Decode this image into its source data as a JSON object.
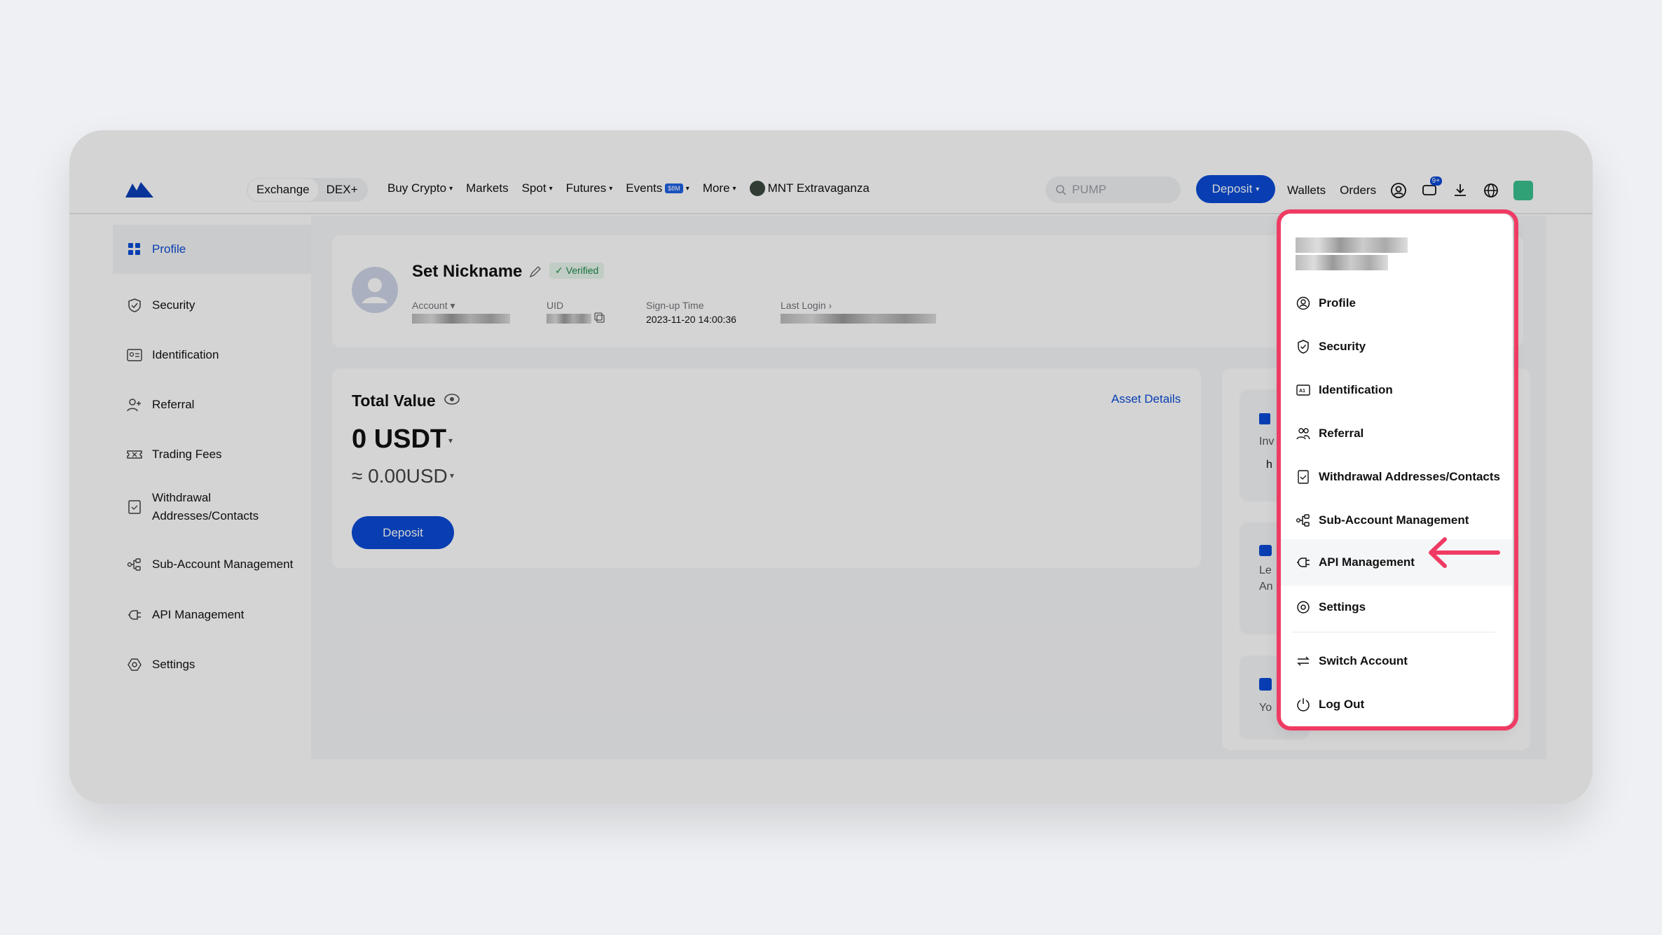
{
  "nav": {
    "toggle": [
      "Exchange",
      "DEX+"
    ],
    "links": [
      {
        "label": "Buy Crypto",
        "caret": "▾"
      },
      {
        "label": "Markets",
        "caret": ""
      },
      {
        "label": "Spot",
        "caret": "▾"
      },
      {
        "label": "Futures",
        "caret": "▾"
      },
      {
        "label": "Events",
        "caret": "▾",
        "badge": "$8M"
      },
      {
        "label": "More",
        "caret": "▾"
      }
    ],
    "promo": "MNT Extravaganza",
    "search_placeholder": "PUMP",
    "deposit_label": "Deposit",
    "wallets": "Wallets",
    "orders": "Orders",
    "notif_badge": "9+"
  },
  "sidebar": {
    "items": [
      {
        "label": "Profile",
        "icon": "grid-icon"
      },
      {
        "label": "Security",
        "icon": "shield-icon"
      },
      {
        "label": "Identification",
        "icon": "id-card-icon"
      },
      {
        "label": "Referral",
        "icon": "add-user-icon"
      },
      {
        "label": "Trading Fees",
        "icon": "fee-ticket-icon"
      },
      {
        "label": "Withdrawal\nAddresses/Contacts",
        "icon": "address-book-icon"
      },
      {
        "label": "Sub-Account Management",
        "icon": "sub-account-icon"
      },
      {
        "label": "API Management",
        "icon": "api-plug-icon"
      },
      {
        "label": "Settings",
        "icon": "gear-icon"
      }
    ]
  },
  "profile": {
    "nickname": "Set Nickname",
    "verified": "Verified",
    "account_label": "Account",
    "uid_label": "UID",
    "signup_label": "Sign-up Time",
    "signup_value": "2023-11-20 14:00:36",
    "last_login_label": "Last Login"
  },
  "assets": {
    "title": "Total Value",
    "details_link": "Asset Details",
    "usdt": "0 USDT",
    "usd": "≈ 0.00USD",
    "deposit": "Deposit"
  },
  "right_cards": {
    "lines": [
      "Inv",
      "h",
      "Le",
      "An",
      "Yo"
    ]
  },
  "dropdown": {
    "items": [
      {
        "label": "Profile",
        "icon": "user-circle-icon"
      },
      {
        "label": "Security",
        "icon": "shield-icon"
      },
      {
        "label": "Identification",
        "icon": "id-card-icon"
      },
      {
        "label": "Referral",
        "icon": "people-icon"
      },
      {
        "label": "Withdrawal Addresses/Contacts",
        "icon": "address-book-icon"
      },
      {
        "label": "Sub-Account Management",
        "icon": "sub-account-icon"
      },
      {
        "label": "API Management",
        "icon": "api-plug-icon"
      },
      {
        "label": "Settings",
        "icon": "gear-icon"
      },
      {
        "label": "Switch Account",
        "icon": "switch-icon"
      },
      {
        "label": "Log Out",
        "icon": "power-icon"
      }
    ],
    "highlight_color": "#ef3b63"
  },
  "colors": {
    "accent": "#0a4bd6",
    "annotation": "#ef3b63"
  }
}
